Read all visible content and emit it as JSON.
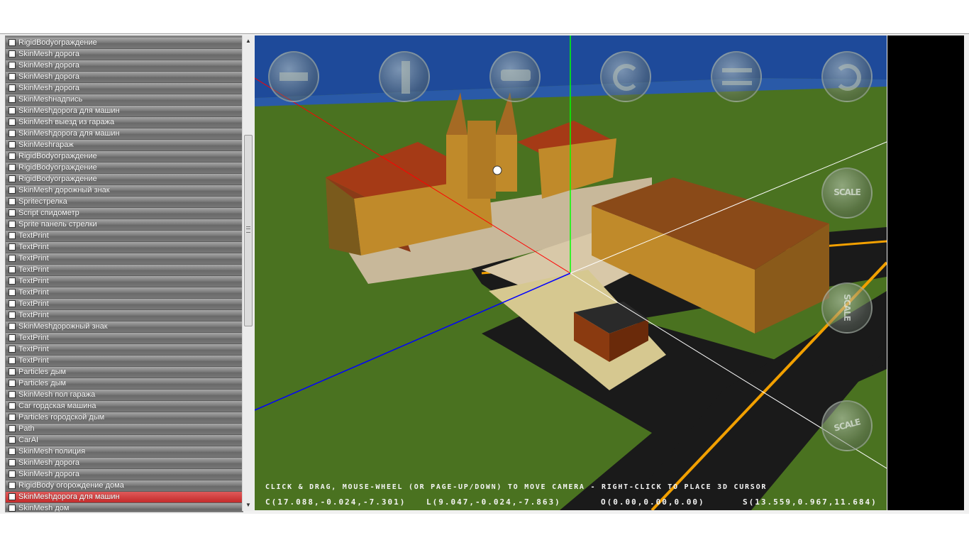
{
  "object_list": {
    "items": [
      {
        "label": "RigidBodyограждение"
      },
      {
        "label": "SkinMesh дорога"
      },
      {
        "label": "SkinMesh дорога"
      },
      {
        "label": "SkinMesh дорога"
      },
      {
        "label": "SkinMesh дорога"
      },
      {
        "label": "SkinMeshнадпись"
      },
      {
        "label": "SkinMeshдорога для машин"
      },
      {
        "label": "SkinMesh выезд из гаража"
      },
      {
        "label": "SkinMeshдорога для машин"
      },
      {
        "label": "SkinMeshгараж"
      },
      {
        "label": "RigidBodyограждение"
      },
      {
        "label": "RigidBodyограждение"
      },
      {
        "label": "RigidBodyограждение"
      },
      {
        "label": "SkinMesh дорожный знак"
      },
      {
        "label": "Spriteстрелка"
      },
      {
        "label": "Script спидометр"
      },
      {
        "label": "Sprite панель стрелки"
      },
      {
        "label": "TextPrint"
      },
      {
        "label": "TextPrint"
      },
      {
        "label": "TextPrint"
      },
      {
        "label": "TextPrint"
      },
      {
        "label": "TextPrint"
      },
      {
        "label": "TextPrint"
      },
      {
        "label": "TextPrint"
      },
      {
        "label": "TextPrint"
      },
      {
        "label": "SkinMeshдорожный знак"
      },
      {
        "label": "TextPrint"
      },
      {
        "label": "TextPrint"
      },
      {
        "label": "TextPrint"
      },
      {
        "label": "Particles дым"
      },
      {
        "label": "Particles дым"
      },
      {
        "label": "SkinMesh пол гаража"
      },
      {
        "label": "Car гордская машина"
      },
      {
        "label": "Particles городской дым"
      },
      {
        "label": "Path"
      },
      {
        "label": "CarAI"
      },
      {
        "label": "SkinMesh полиция"
      },
      {
        "label": "SkinMesh дорога"
      },
      {
        "label": "SkinMesh дорога"
      },
      {
        "label": "RigidBody огорождение дома"
      },
      {
        "label": "SkinMeshдорога для машин",
        "selected": true
      },
      {
        "label": "SkinMesh дом"
      }
    ]
  },
  "viewport": {
    "hint": "CLICK & DRAG, MOUSE-WHEEL (OR PAGE-UP/DOWN) TO MOVE CAMERA - RIGHT-CLICK TO PLACE 3D CURSOR",
    "camera": "C(17.088,-0.024,-7.301)",
    "look": "L(9.047,-0.024,-7.863)",
    "orientation": "O(0.00,0.00,0.00)",
    "scale": "S(13.559,0.967,11.684)",
    "scale_label_1": "SCALE",
    "scale_label_2": "SCALE",
    "scale_label_3": "SCALE",
    "colors": {
      "sky": "#1e4a9a",
      "ground": "#4a7220",
      "road": "#1a1a1a",
      "building": "#c08a2a",
      "roof": "#a53a16"
    }
  }
}
